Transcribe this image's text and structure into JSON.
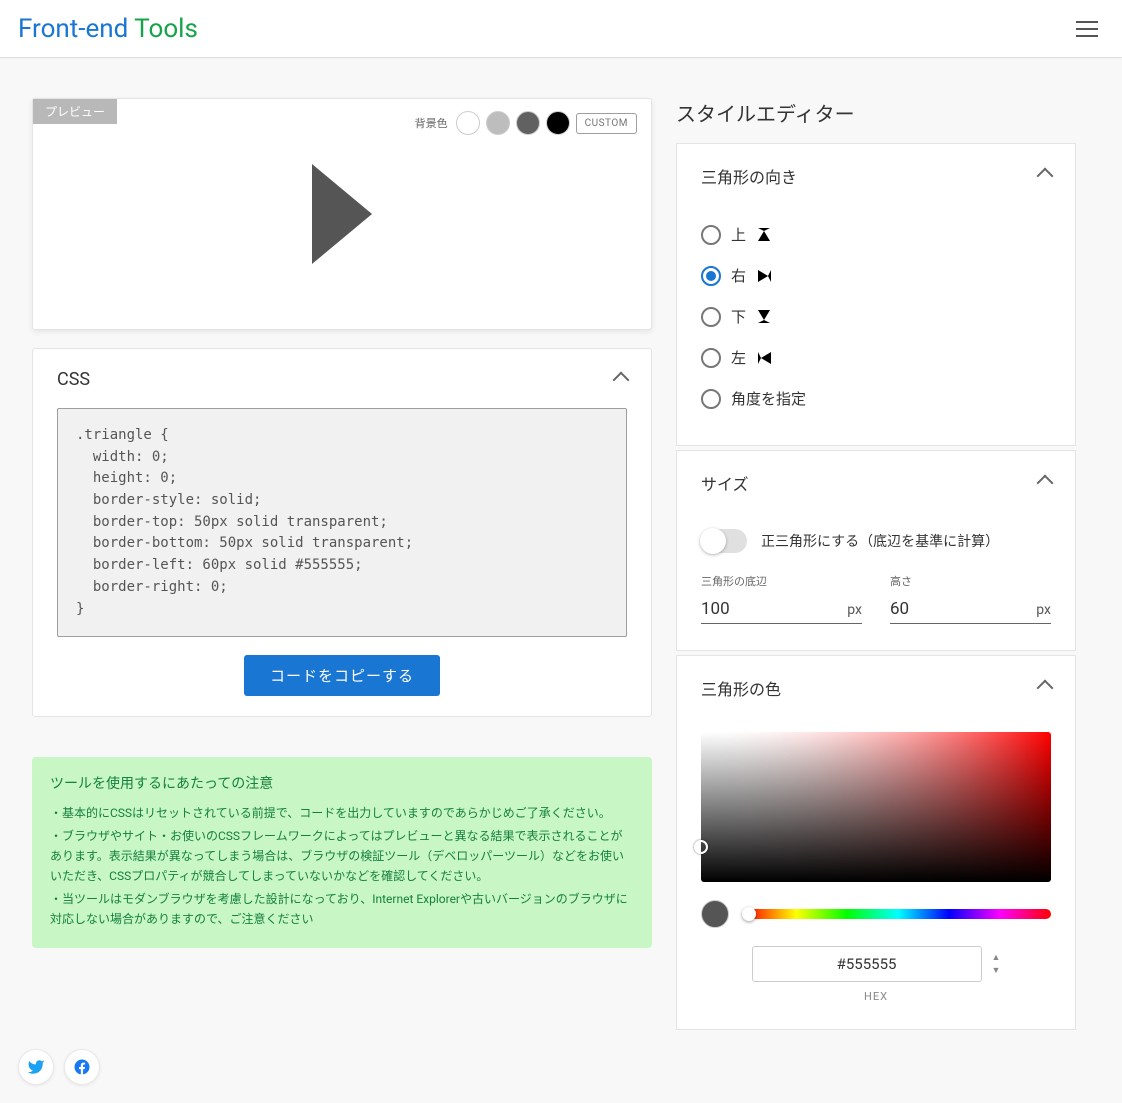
{
  "brand": {
    "part1": "Front-end ",
    "part2": "Tools"
  },
  "preview": {
    "tag": "プレビュー",
    "bg_label": "背景色",
    "custom": "CUSTOM"
  },
  "css": {
    "title": "CSS",
    "code": ".triangle {\n  width: 0;\n  height: 0;\n  border-style: solid;\n  border-top: 50px solid transparent;\n  border-bottom: 50px solid transparent;\n  border-left: 60px solid #555555;\n  border-right: 0;\n}",
    "copy": "コードをコピーする"
  },
  "notice": {
    "title": "ツールを使用するにあたっての注意",
    "items": [
      "・基本的にCSSはリセットされている前提で、コードを出力していますのであらかじめご了承ください。",
      "・ブラウザやサイト・お使いのCSSフレームワークによってはプレビューと異なる結果で表示されることがあります。表示結果が異なってしまう場合は、ブラウザの検証ツール（デベロッパーツール）などをお使いいただき、CSSプロパティが競合してしまっていないかなどを確認してください。",
      "・当ツールはモダンブラウザを考慮した設計になっており、Internet Explorerや古いバージョンのブラウザに対応しない場合がありますので、ご注意ください"
    ]
  },
  "editor": {
    "title": "スタイルエディター"
  },
  "direction": {
    "title": "三角形の向き",
    "options": {
      "up": "上",
      "right": "右",
      "down": "下",
      "left": "左",
      "angle": "角度を指定"
    },
    "selected": "right"
  },
  "size": {
    "title": "サイズ",
    "equilateral": "正三角形にする（底辺を基準に計算）",
    "base_label": "三角形の底辺",
    "height_label": "高さ",
    "base_value": "100",
    "height_value": "60",
    "unit": "px"
  },
  "color": {
    "title": "三角形の色",
    "hex": "#555555",
    "mode": "HEX"
  }
}
